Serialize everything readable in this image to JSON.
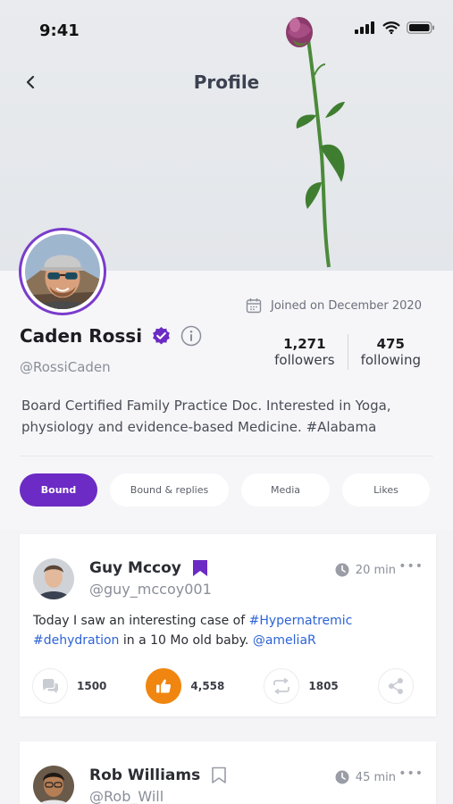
{
  "status_bar": {
    "time": "9:41"
  },
  "header": {
    "title": "Profile"
  },
  "profile": {
    "name": "Caden Rossi",
    "handle": "@RossiCaden",
    "joined": "Joined on December 2020",
    "followers_count": "1,271",
    "followers_label": "followers",
    "following_count": "475",
    "following_label": "following",
    "bio": "Board Certified Family Practice Doc. Interested in Yoga, physiology and evidence-based Medicine. #Alabama"
  },
  "tabs": [
    {
      "label": "Bound",
      "active": true
    },
    {
      "label": "Bound & replies",
      "active": false
    },
    {
      "label": "Media",
      "active": false
    },
    {
      "label": "Likes",
      "active": false
    }
  ],
  "posts": [
    {
      "author": "Guy Mccoy",
      "handle": "@guy_mccoy001",
      "time": "20 min",
      "bookmarked": true,
      "text_plain_1": "Today I saw an interesting case of ",
      "tag_1": "#Hypernatremic",
      "tag_2": "#dehydration",
      "text_plain_2": " in a 10 Mo old baby. ",
      "mention": "@ameliaR",
      "comments": "1500",
      "likes": "4,558",
      "reposts": "1805"
    },
    {
      "author": "Rob Williams",
      "handle": "@Rob_Will",
      "time": "45 min",
      "bookmarked": false
    }
  ],
  "colors": {
    "accent": "#6b2bc4",
    "like": "#f0860f",
    "link": "#2c63d6"
  }
}
